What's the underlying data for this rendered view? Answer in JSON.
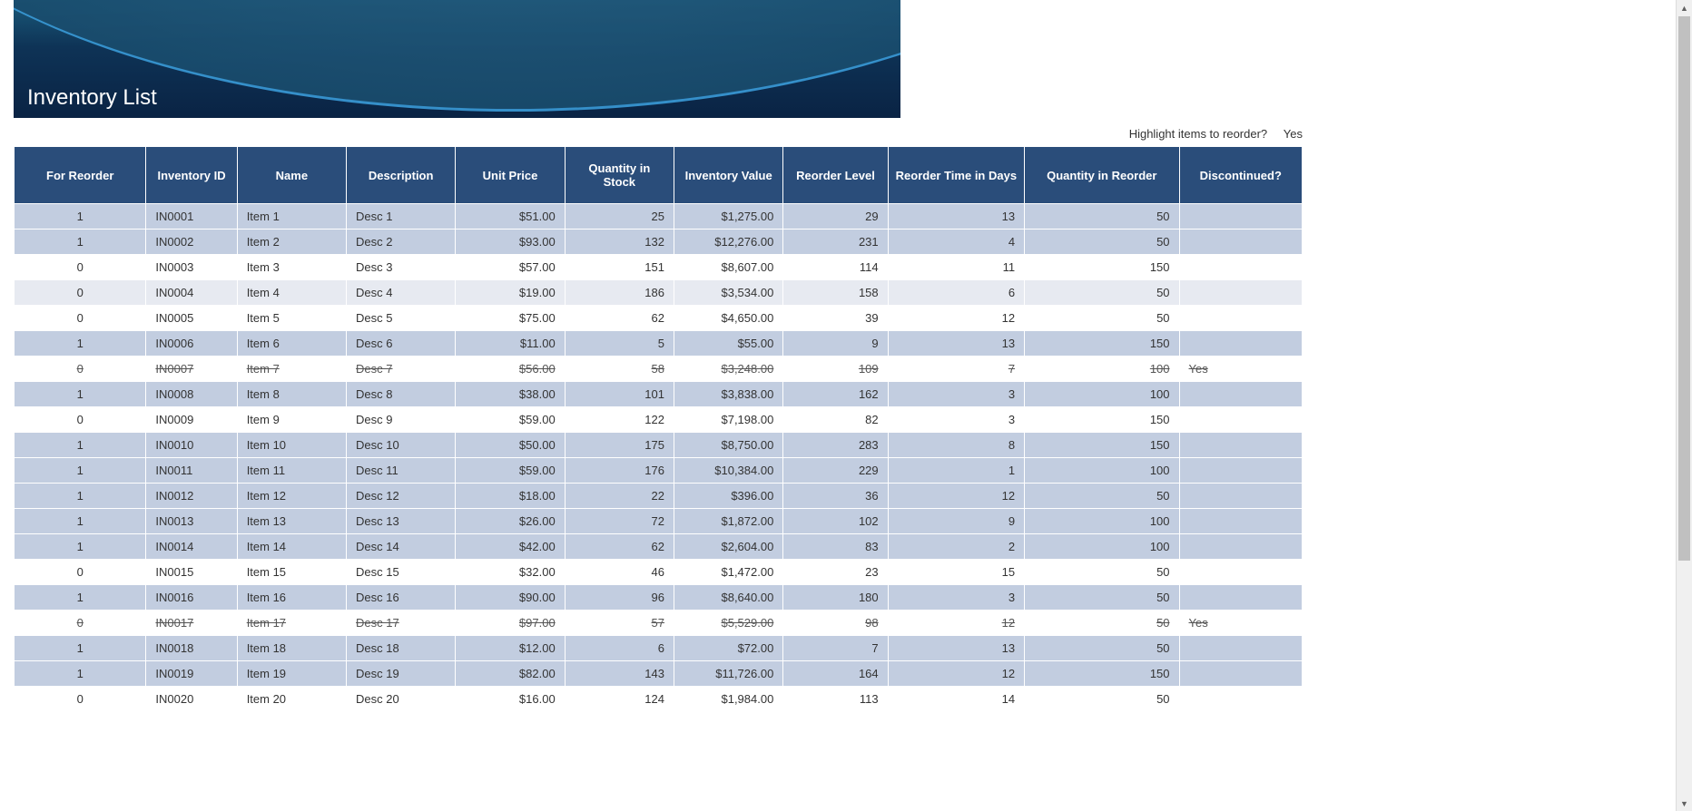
{
  "banner": {
    "title": "Inventory List"
  },
  "highlight": {
    "label": "Highlight items to reorder?",
    "value": "Yes"
  },
  "columns": [
    "For Reorder",
    "Inventory ID",
    "Name",
    "Description",
    "Unit Price",
    "Quantity in Stock",
    "Inventory Value",
    "Reorder Level",
    "Reorder Time in Days",
    "Quantity in Reorder",
    "Discontinued?"
  ],
  "rows": [
    {
      "reorder": "1",
      "id": "IN0001",
      "name": "Item 1",
      "desc": "Desc 1",
      "price": "$51.00",
      "qty": "25",
      "val": "$1,275.00",
      "rlvl": "29",
      "rtime": "13",
      "rqty": "50",
      "disc": "",
      "hl": true,
      "strike": false
    },
    {
      "reorder": "1",
      "id": "IN0002",
      "name": "Item 2",
      "desc": "Desc 2",
      "price": "$93.00",
      "qty": "132",
      "val": "$12,276.00",
      "rlvl": "231",
      "rtime": "4",
      "rqty": "50",
      "disc": "",
      "hl": true,
      "strike": false
    },
    {
      "reorder": "0",
      "id": "IN0003",
      "name": "Item 3",
      "desc": "Desc 3",
      "price": "$57.00",
      "qty": "151",
      "val": "$8,607.00",
      "rlvl": "114",
      "rtime": "11",
      "rqty": "150",
      "disc": "",
      "hl": false,
      "strike": false
    },
    {
      "reorder": "0",
      "id": "IN0004",
      "name": "Item 4",
      "desc": "Desc 4",
      "price": "$19.00",
      "qty": "186",
      "val": "$3,534.00",
      "rlvl": "158",
      "rtime": "6",
      "rqty": "50",
      "disc": "",
      "hl": false,
      "alt": true,
      "strike": false
    },
    {
      "reorder": "0",
      "id": "IN0005",
      "name": "Item 5",
      "desc": "Desc 5",
      "price": "$75.00",
      "qty": "62",
      "val": "$4,650.00",
      "rlvl": "39",
      "rtime": "12",
      "rqty": "50",
      "disc": "",
      "hl": false,
      "strike": false
    },
    {
      "reorder": "1",
      "id": "IN0006",
      "name": "Item 6",
      "desc": "Desc 6",
      "price": "$11.00",
      "qty": "5",
      "val": "$55.00",
      "rlvl": "9",
      "rtime": "13",
      "rqty": "150",
      "disc": "",
      "hl": true,
      "strike": false
    },
    {
      "reorder": "0",
      "id": "IN0007",
      "name": "Item 7",
      "desc": "Desc 7",
      "price": "$56.00",
      "qty": "58",
      "val": "$3,248.00",
      "rlvl": "109",
      "rtime": "7",
      "rqty": "100",
      "disc": "Yes",
      "hl": false,
      "strike": true
    },
    {
      "reorder": "1",
      "id": "IN0008",
      "name": "Item 8",
      "desc": "Desc 8",
      "price": "$38.00",
      "qty": "101",
      "val": "$3,838.00",
      "rlvl": "162",
      "rtime": "3",
      "rqty": "100",
      "disc": "",
      "hl": true,
      "strike": false
    },
    {
      "reorder": "0",
      "id": "IN0009",
      "name": "Item 9",
      "desc": "Desc 9",
      "price": "$59.00",
      "qty": "122",
      "val": "$7,198.00",
      "rlvl": "82",
      "rtime": "3",
      "rqty": "150",
      "disc": "",
      "hl": false,
      "strike": false
    },
    {
      "reorder": "1",
      "id": "IN0010",
      "name": "Item 10",
      "desc": "Desc 10",
      "price": "$50.00",
      "qty": "175",
      "val": "$8,750.00",
      "rlvl": "283",
      "rtime": "8",
      "rqty": "150",
      "disc": "",
      "hl": true,
      "strike": false
    },
    {
      "reorder": "1",
      "id": "IN0011",
      "name": "Item 11",
      "desc": "Desc 11",
      "price": "$59.00",
      "qty": "176",
      "val": "$10,384.00",
      "rlvl": "229",
      "rtime": "1",
      "rqty": "100",
      "disc": "",
      "hl": true,
      "strike": false
    },
    {
      "reorder": "1",
      "id": "IN0012",
      "name": "Item 12",
      "desc": "Desc 12",
      "price": "$18.00",
      "qty": "22",
      "val": "$396.00",
      "rlvl": "36",
      "rtime": "12",
      "rqty": "50",
      "disc": "",
      "hl": true,
      "strike": false
    },
    {
      "reorder": "1",
      "id": "IN0013",
      "name": "Item 13",
      "desc": "Desc 13",
      "price": "$26.00",
      "qty": "72",
      "val": "$1,872.00",
      "rlvl": "102",
      "rtime": "9",
      "rqty": "100",
      "disc": "",
      "hl": true,
      "strike": false
    },
    {
      "reorder": "1",
      "id": "IN0014",
      "name": "Item 14",
      "desc": "Desc 14",
      "price": "$42.00",
      "qty": "62",
      "val": "$2,604.00",
      "rlvl": "83",
      "rtime": "2",
      "rqty": "100",
      "disc": "",
      "hl": true,
      "strike": false
    },
    {
      "reorder": "0",
      "id": "IN0015",
      "name": "Item 15",
      "desc": "Desc 15",
      "price": "$32.00",
      "qty": "46",
      "val": "$1,472.00",
      "rlvl": "23",
      "rtime": "15",
      "rqty": "50",
      "disc": "",
      "hl": false,
      "strike": false
    },
    {
      "reorder": "1",
      "id": "IN0016",
      "name": "Item 16",
      "desc": "Desc 16",
      "price": "$90.00",
      "qty": "96",
      "val": "$8,640.00",
      "rlvl": "180",
      "rtime": "3",
      "rqty": "50",
      "disc": "",
      "hl": true,
      "strike": false
    },
    {
      "reorder": "0",
      "id": "IN0017",
      "name": "Item 17",
      "desc": "Desc 17",
      "price": "$97.00",
      "qty": "57",
      "val": "$5,529.00",
      "rlvl": "98",
      "rtime": "12",
      "rqty": "50",
      "disc": "Yes",
      "hl": false,
      "strike": true
    },
    {
      "reorder": "1",
      "id": "IN0018",
      "name": "Item 18",
      "desc": "Desc 18",
      "price": "$12.00",
      "qty": "6",
      "val": "$72.00",
      "rlvl": "7",
      "rtime": "13",
      "rqty": "50",
      "disc": "",
      "hl": true,
      "strike": false
    },
    {
      "reorder": "1",
      "id": "IN0019",
      "name": "Item 19",
      "desc": "Desc 19",
      "price": "$82.00",
      "qty": "143",
      "val": "$11,726.00",
      "rlvl": "164",
      "rtime": "12",
      "rqty": "150",
      "disc": "",
      "hl": true,
      "strike": false
    },
    {
      "reorder": "0",
      "id": "IN0020",
      "name": "Item 20",
      "desc": "Desc 20",
      "price": "$16.00",
      "qty": "124",
      "val": "$1,984.00",
      "rlvl": "113",
      "rtime": "14",
      "rqty": "50",
      "disc": "",
      "hl": false,
      "strike": false
    }
  ]
}
